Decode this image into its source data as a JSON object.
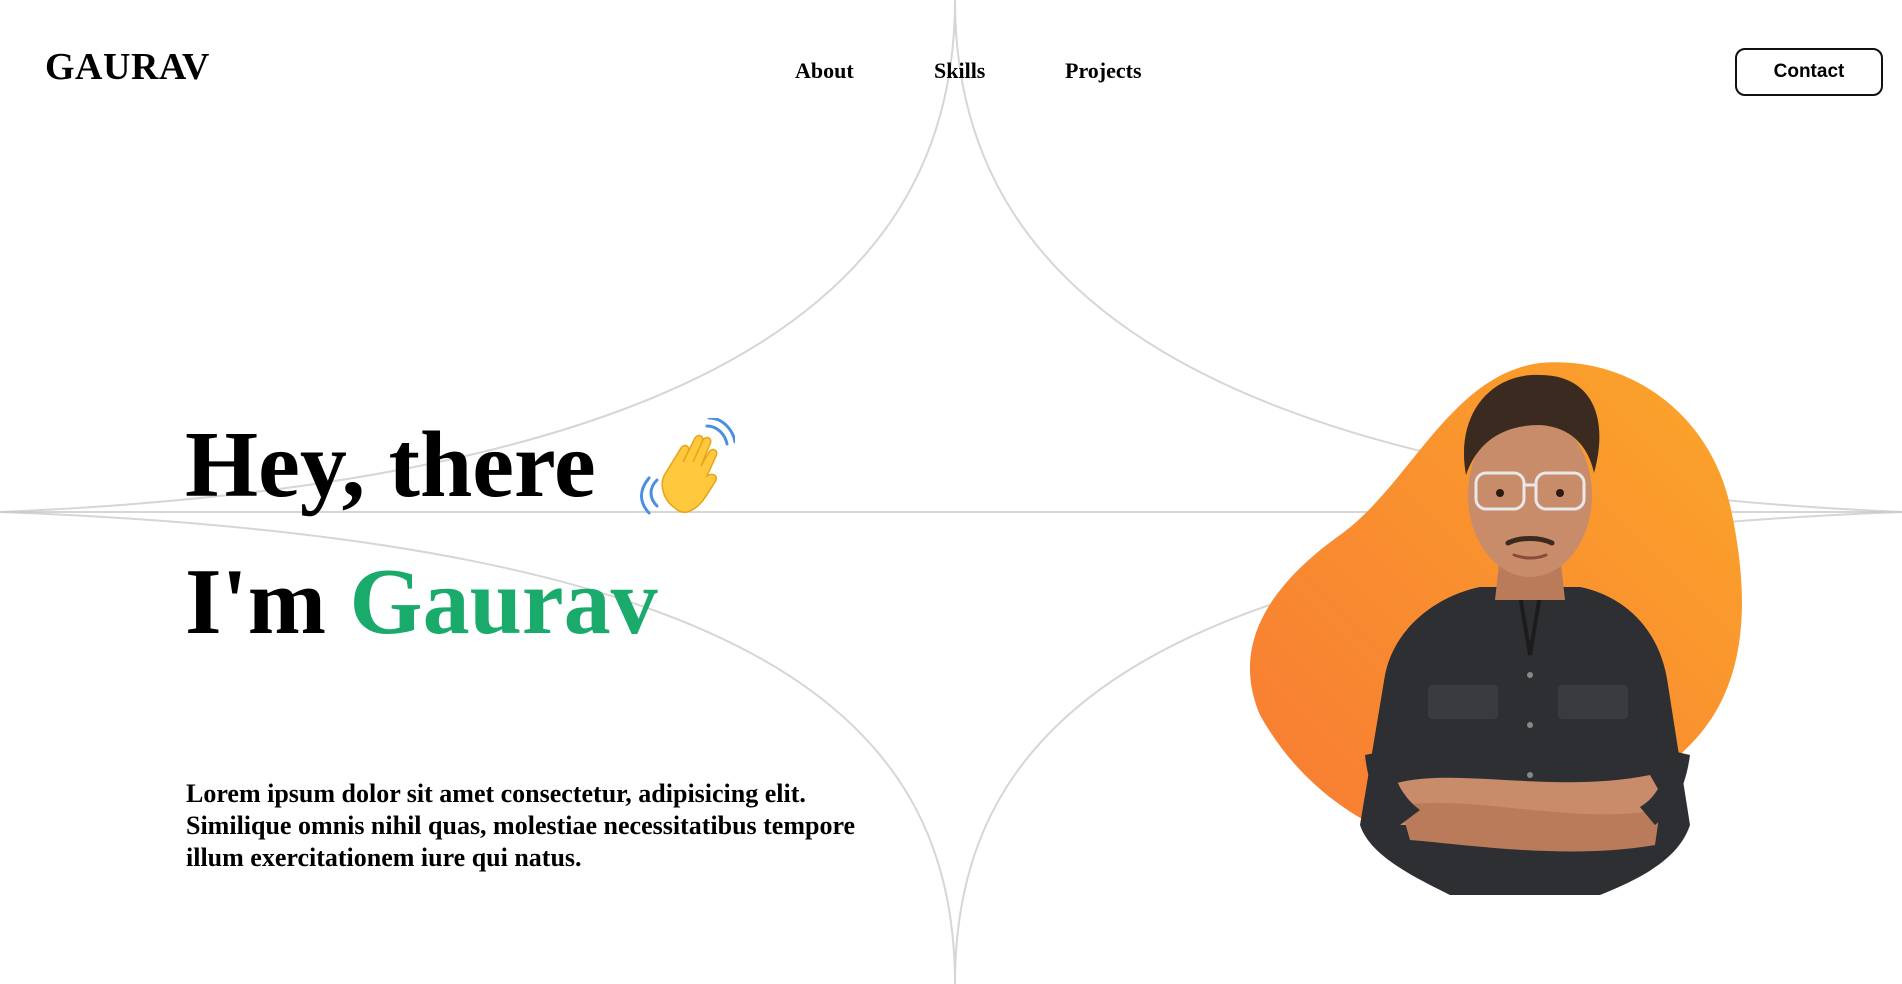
{
  "header": {
    "logo": "GAURAV",
    "nav": [
      {
        "label": "About"
      },
      {
        "label": "Skills"
      },
      {
        "label": "Projects"
      }
    ],
    "contact_label": "Contact"
  },
  "hero": {
    "greeting": "Hey, there",
    "intro_prefix": "I'm",
    "name": "Gaurav",
    "wave_icon": "waving-hand-icon",
    "description": "Lorem ipsum dolor sit amet consectetur, adipisicing elit. Similique omnis nihil quas, molestiae necessitatibus tempore illum exercitationem iure qui natus."
  },
  "colors": {
    "accent_green": "#1aab6c",
    "blob_orange_light": "#fba52a",
    "blob_orange_dark": "#f77a34",
    "line_gray": "#d6d6d6"
  }
}
